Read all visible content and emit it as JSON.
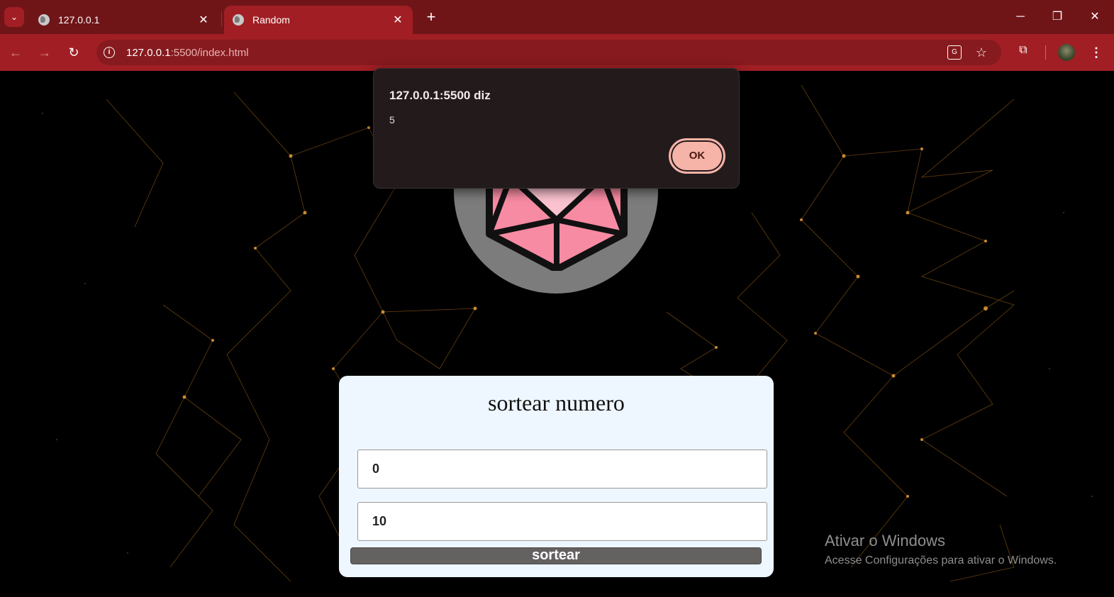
{
  "browser": {
    "tabs": [
      {
        "title": "127.0.0.1",
        "active": false
      },
      {
        "title": "Random",
        "active": true
      }
    ],
    "url_host": "127.0.0.1",
    "url_rest": ":5500/index.html",
    "colors": {
      "tabbar": "#6f1518",
      "toolbar": "#a11f24"
    }
  },
  "dialog": {
    "title": "127.0.0.1:5500 diz",
    "message": "5",
    "ok_label": "OK"
  },
  "app": {
    "dice_label": "20",
    "title": "sortear numero",
    "min_value": "0",
    "max_value": "10",
    "button_label": "sortear"
  },
  "watermark": {
    "title": "Ativar o Windows",
    "subtitle": "Acesse Configurações para ativar o Windows."
  }
}
